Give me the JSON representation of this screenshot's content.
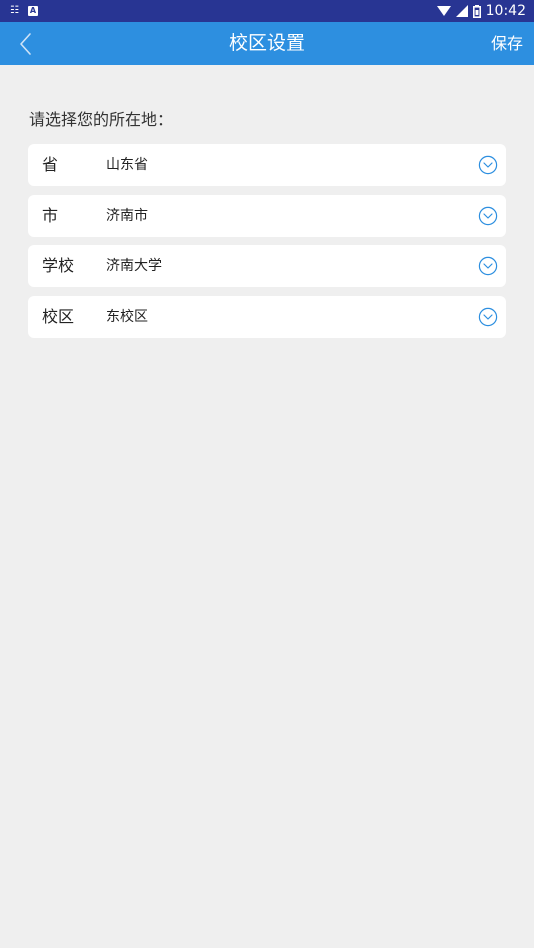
{
  "status_bar": {
    "left_icons": [
      "notification-app-icon",
      "text-app-icon"
    ],
    "time": "10:42"
  },
  "nav": {
    "back_icon": "chevron-left-icon",
    "title": "校区设置",
    "save_label": "保存"
  },
  "prompt": "请选择您的所在地：",
  "rows": [
    {
      "label": "省",
      "value": "山东省"
    },
    {
      "label": "市",
      "value": "济南市"
    },
    {
      "label": "学校",
      "value": "济南大学"
    },
    {
      "label": "校区",
      "value": "东校区"
    }
  ],
  "colors": {
    "status_bar": "#283593",
    "nav_bar": "#2d8fe0",
    "background": "#efefef",
    "accent_icon": "#2d8fe0"
  }
}
